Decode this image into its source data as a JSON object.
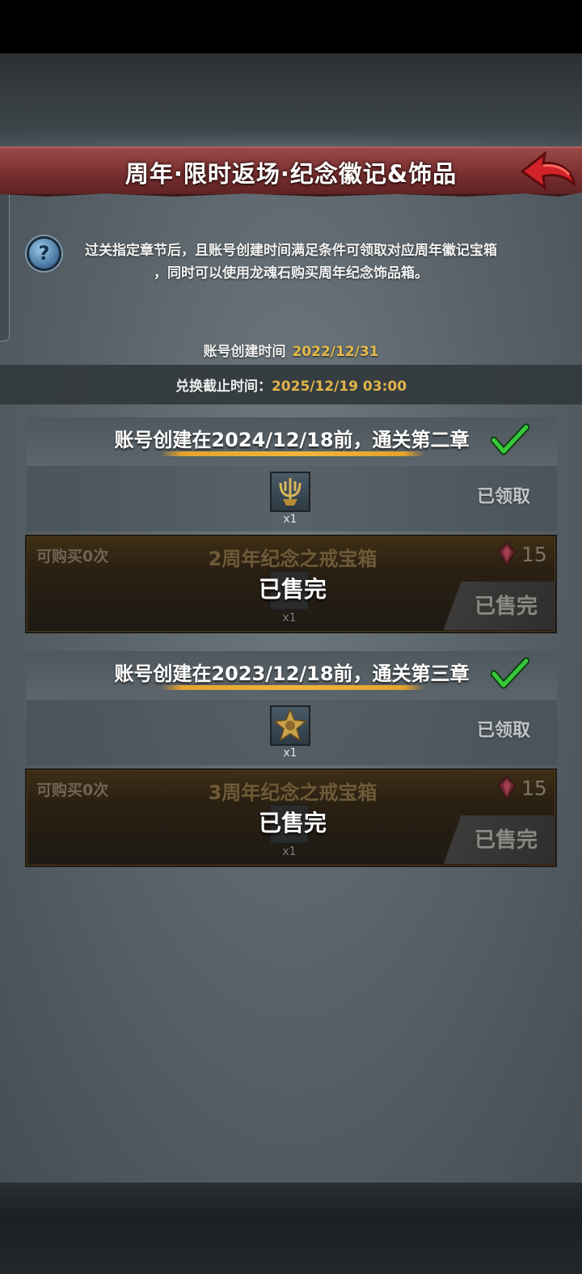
{
  "header": {
    "title": "周年·限时返场·纪念徽记&饰品"
  },
  "info": {
    "help_icon_symbol": "?",
    "description_line1": "过关指定章节后，且账号创建时间满足条件可领取对应周年徽记宝箱",
    "description_line2": "，同时可以使用龙魂石购买周年纪念饰品箱。",
    "created_label": "账号创建时间",
    "created_value": "2022/12/31",
    "deadline_label": "兑换截止时间：",
    "deadline_value": "2025/12/19 03:00"
  },
  "rewards": [
    {
      "title": "账号创建在2024/12/18前，通关第二章",
      "item_icon": "trident-badge-icon",
      "quantity": "x1",
      "status": "已领取",
      "shop": {
        "limit": "可购买0次",
        "name": "2周年纪念之戒宝箱",
        "price": "15",
        "currency_icon": "dragon-soul-gem-icon",
        "quantity": "x1",
        "soldout_center": "已售完",
        "soldout_button": "已售完"
      }
    },
    {
      "title": "账号创建在2023/12/18前，通关第三章",
      "item_icon": "star-crest-badge-icon",
      "quantity": "x1",
      "status": "已领取",
      "shop": {
        "limit": "可购买0次",
        "name": "3周年纪念之戒宝箱",
        "price": "15",
        "currency_icon": "dragon-soul-gem-icon",
        "quantity": "x1",
        "soldout_center": "已售完",
        "soldout_button": "已售完"
      }
    }
  ],
  "colors": {
    "title_bar": "#7a2f2f",
    "gold_text": "#e2b44a",
    "check_green": "#37c83a",
    "back_arrow": "#d2232a"
  }
}
